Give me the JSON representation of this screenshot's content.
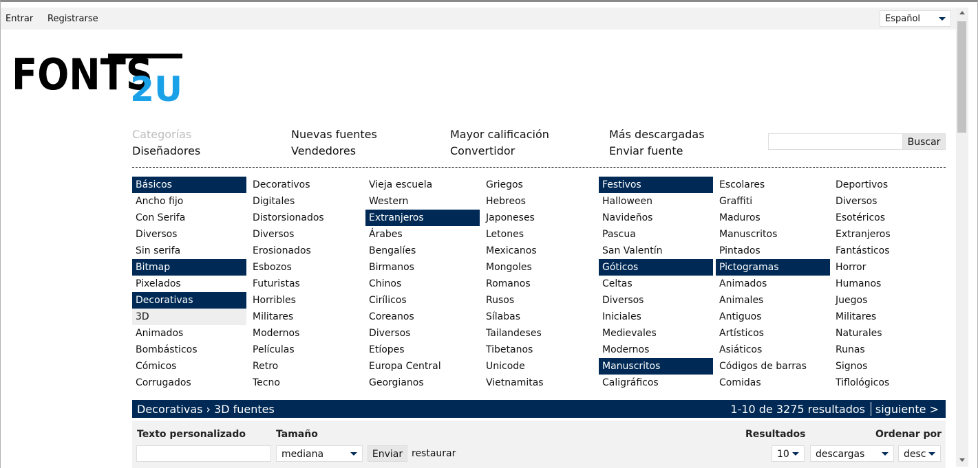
{
  "topbar": {
    "login": "Entrar",
    "register": "Registrarse",
    "language": "Español"
  },
  "logo": {
    "text_main": "FONTS",
    "text_accent": "2U",
    "colors": {
      "main": "#000000",
      "accent": "#1ba1e8"
    }
  },
  "nav": {
    "row1": [
      "Categorías",
      "Nuevas fuentes",
      "Mayor calificación",
      "Más descargadas"
    ],
    "row2": [
      "Diseñadores",
      "Vendedores",
      "Convertidor",
      "Enviar fuente"
    ]
  },
  "search": {
    "button": "Buscar",
    "value": ""
  },
  "categories": [
    [
      {
        "label": "Básicos",
        "type": "head"
      },
      {
        "label": "Ancho fijo"
      },
      {
        "label": "Con Serifa"
      },
      {
        "label": "Diversos"
      },
      {
        "label": "Sin serifa"
      },
      {
        "label": "Bitmap",
        "type": "head"
      },
      {
        "label": "Pixelados"
      },
      {
        "label": "Decorativas",
        "type": "head"
      },
      {
        "label": "3D",
        "type": "selected"
      },
      {
        "label": "Animados"
      },
      {
        "label": "Bombásticos"
      },
      {
        "label": "Cómicos"
      },
      {
        "label": "Corrugados"
      }
    ],
    [
      {
        "label": "Decorativos"
      },
      {
        "label": "Digitales"
      },
      {
        "label": "Distorsionados"
      },
      {
        "label": "Diversos"
      },
      {
        "label": "Erosionados"
      },
      {
        "label": "Esbozos"
      },
      {
        "label": "Futuristas"
      },
      {
        "label": "Horribles"
      },
      {
        "label": "Militares"
      },
      {
        "label": "Modernos"
      },
      {
        "label": "Películas"
      },
      {
        "label": "Retro"
      },
      {
        "label": "Tecno"
      }
    ],
    [
      {
        "label": "Vieja escuela"
      },
      {
        "label": "Western"
      },
      {
        "label": "Extranjeros",
        "type": "head"
      },
      {
        "label": "Árabes"
      },
      {
        "label": "Bengalíes"
      },
      {
        "label": "Birmanos"
      },
      {
        "label": "Chinos"
      },
      {
        "label": "Cirílicos"
      },
      {
        "label": "Coreanos"
      },
      {
        "label": "Diversos"
      },
      {
        "label": "Etíopes"
      },
      {
        "label": "Europa Central"
      },
      {
        "label": "Georgianos"
      }
    ],
    [
      {
        "label": "Griegos"
      },
      {
        "label": "Hebreos"
      },
      {
        "label": "Japoneses"
      },
      {
        "label": "Letones"
      },
      {
        "label": "Mexicanos"
      },
      {
        "label": "Mongoles"
      },
      {
        "label": "Romanos"
      },
      {
        "label": "Rusos"
      },
      {
        "label": "Sílabas"
      },
      {
        "label": "Tailandeses"
      },
      {
        "label": "Tibetanos"
      },
      {
        "label": "Unicode"
      },
      {
        "label": "Vietnamitas"
      }
    ],
    [
      {
        "label": "Festivos",
        "type": "head"
      },
      {
        "label": "Halloween"
      },
      {
        "label": "Navideños"
      },
      {
        "label": "Pascua"
      },
      {
        "label": "San Valentín"
      },
      {
        "label": "Góticos",
        "type": "head"
      },
      {
        "label": "Celtas"
      },
      {
        "label": "Diversos"
      },
      {
        "label": "Iniciales"
      },
      {
        "label": "Medievales"
      },
      {
        "label": "Modernos"
      },
      {
        "label": "Manuscritos",
        "type": "head"
      },
      {
        "label": "Caligráficos"
      }
    ],
    [
      {
        "label": "Escolares"
      },
      {
        "label": "Graffiti"
      },
      {
        "label": "Maduros"
      },
      {
        "label": "Manuscritos"
      },
      {
        "label": "Pintados"
      },
      {
        "label": "Pictogramas",
        "type": "head"
      },
      {
        "label": "Animados"
      },
      {
        "label": "Animales"
      },
      {
        "label": "Antiguos"
      },
      {
        "label": "Artísticos"
      },
      {
        "label": "Asiáticos"
      },
      {
        "label": "Códigos de barras"
      },
      {
        "label": "Comidas"
      }
    ],
    [
      {
        "label": "Deportivos"
      },
      {
        "label": "Diversos"
      },
      {
        "label": "Esotéricos"
      },
      {
        "label": "Extranjeros"
      },
      {
        "label": "Fantásticos"
      },
      {
        "label": "Horror"
      },
      {
        "label": "Humanos"
      },
      {
        "label": "Juegos"
      },
      {
        "label": "Militares"
      },
      {
        "label": "Naturales"
      },
      {
        "label": "Runas"
      },
      {
        "label": "Signos"
      },
      {
        "label": "Tiflológicos"
      }
    ]
  ],
  "results_bar": {
    "breadcrumb": "Decorativas › 3D fuentes",
    "count": "1-10 de 3275 resultados",
    "next": "siguiente >"
  },
  "filters": {
    "custom_text_label": "Texto personalizado",
    "custom_text_value": "",
    "size_label": "Tamaño",
    "size_value": "mediana",
    "send_button": "Enviar",
    "reset_link": "restaurar",
    "results_label": "Resultados",
    "results_value": "10",
    "order_label": "Ordenar por",
    "order_value": "descargas",
    "direction_value": "desc"
  },
  "colors": {
    "navy": "#002a55",
    "selected_bg": "#eeeeee",
    "toolbar_bg": "#f2f2f2"
  }
}
